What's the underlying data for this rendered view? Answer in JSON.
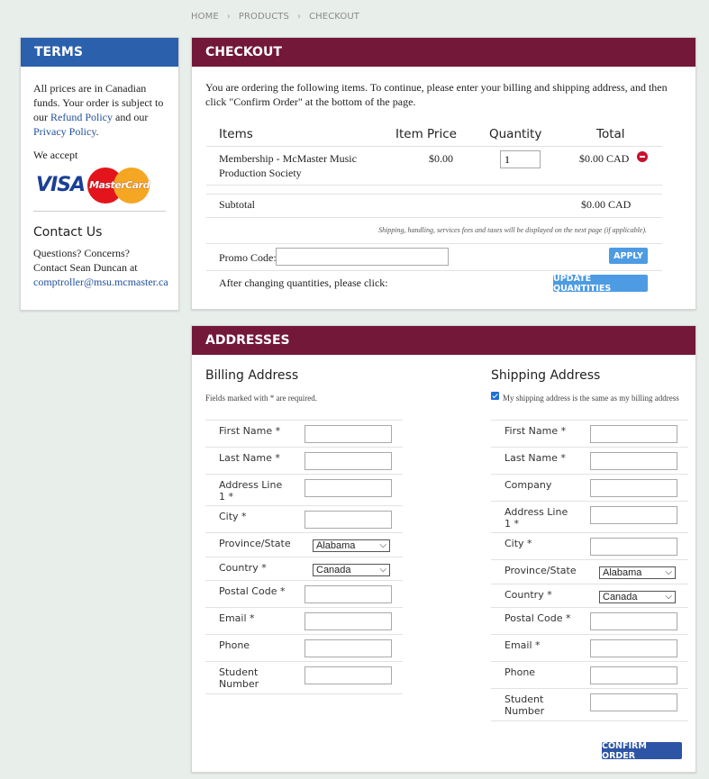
{
  "breadcrumb": [
    "HOME",
    "PRODUCTS",
    "CHECKOUT"
  ],
  "terms": {
    "title": "TERMS",
    "text_1": "All prices are in Canadian funds. Your order is subject to our ",
    "refund_link": "Refund Policy",
    "text_2": " and our ",
    "privacy_link": "Privacy Policy",
    "text_3": ".",
    "we_accept": "We accept",
    "visa": "VISA",
    "mastercard": "MasterCard",
    "contact_title": "Contact Us",
    "contact_text": "Questions? Concerns? Contact Sean Duncan at",
    "email": "comptroller@msu.mcmaster.ca"
  },
  "checkout": {
    "title": "CHECKOUT",
    "intro": "You are ordering the following items. To continue, please enter your billing and shipping address, and then click \"Confirm Order\" at the bottom of the page.",
    "headers": {
      "items": "Items",
      "price": "Item Price",
      "quantity": "Quantity",
      "total": "Total"
    },
    "item": {
      "name": "Membership - McMaster Music Production Society",
      "price": "$0.00",
      "quantity": "1",
      "total": "$0.00 CAD"
    },
    "subtotal_label": "Subtotal",
    "subtotal_value": "$0.00 CAD",
    "fees_note": "Shipping, handling, services fees and taxes will be displayed on the next page (if applicable).",
    "promo_label": "Promo Code:",
    "promo_value": "",
    "apply_label": "APPLY",
    "update_text": "After changing quantities, please click:",
    "update_label": "UPDATE QUANTITIES"
  },
  "addresses": {
    "title": "ADDRESSES",
    "billing": {
      "title": "Billing Address",
      "note": "Fields marked with * are required.",
      "fields": {
        "first_name": "First Name *",
        "last_name": "Last Name *",
        "address1": "Address Line 1 *",
        "city": "City *",
        "province": "Province/State",
        "province_value": "Alabama",
        "country": "Country *",
        "country_value": "Canada",
        "postal": "Postal Code *",
        "email": "Email *",
        "phone": "Phone",
        "student": "Student Number"
      }
    },
    "shipping": {
      "title": "Shipping Address",
      "same_label": "My shipping address is the same as my billing address",
      "same_checked": true,
      "fields": {
        "first_name": "First Name *",
        "last_name": "Last Name *",
        "company": "Company",
        "address1": "Address Line 1 *",
        "city": "City *",
        "province": "Province/State",
        "province_value": "Alabama",
        "country": "Country *",
        "country_value": "Canada",
        "postal": "Postal Code *",
        "email": "Email *",
        "phone": "Phone",
        "student": "Student Number"
      }
    },
    "confirm_label": "CONFIRM ORDER"
  },
  "colors": {
    "accent_blue": "#2b60ad",
    "maroon": "#731839",
    "button_blue": "#4d9be3",
    "confirm_blue": "#2e55a5"
  }
}
